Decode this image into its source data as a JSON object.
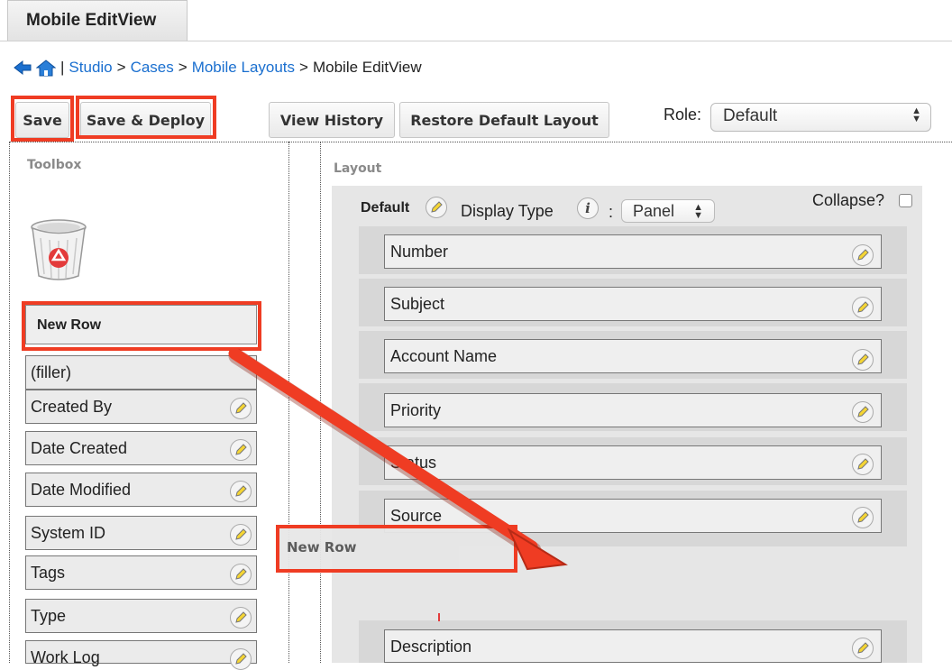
{
  "tab": {
    "label": "Mobile EditView"
  },
  "breadcrumb": {
    "sep": "|",
    "arrow": ">",
    "items": [
      "Studio",
      "Cases",
      "Mobile Layouts"
    ],
    "current": "Mobile EditView"
  },
  "toolbar": {
    "save": "Save",
    "save_deploy": "Save & Deploy",
    "view_history": "View History",
    "restore": "Restore Default Layout",
    "role_label": "Role:",
    "role_value": "Default"
  },
  "toolbox": {
    "title": "Toolbox",
    "new_row": "New Row",
    "fields": [
      "(filler)",
      "Created By",
      "Date Created",
      "Date Modified",
      "System ID",
      "Tags",
      "Type",
      "Work Log"
    ]
  },
  "layout": {
    "title": "Layout",
    "panel_name": "Default",
    "display_type_label": "Display Type",
    "colon": ":",
    "display_type_value": "Panel",
    "collapse_label": "Collapse?",
    "fields": [
      "Number",
      "Subject",
      "Account Name",
      "Priority",
      "Status",
      "Source"
    ],
    "dragging_row": "New Row",
    "description": "Description"
  },
  "colors": {
    "highlight": "#ef3c23",
    "link": "#1a6fcf"
  },
  "icons": [
    "back-arrow-icon",
    "home-icon",
    "trash-bin-icon",
    "pencil-icon",
    "info-icon",
    "drag-arrow-icon"
  ]
}
